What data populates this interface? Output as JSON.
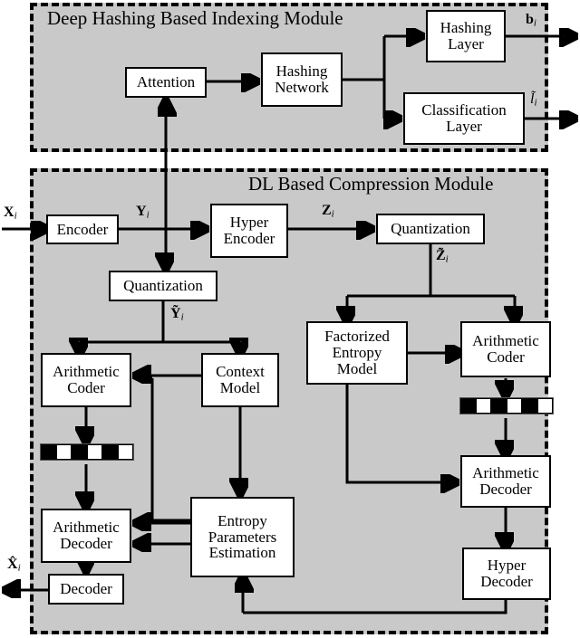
{
  "figure": {
    "title_top": "Deep Hashing Based Indexing Module",
    "title_bottom": "DL Based Compression Module",
    "module_fill": "#c9c9c9",
    "node_fill": "#ffffff",
    "stroke": "#000000"
  },
  "nodes": {
    "attention": "Attention",
    "hashing_network_l1": "Hashing",
    "hashing_network_l2": "Network",
    "hashing_layer_l1": "Hashing",
    "hashing_layer_l2": "Layer",
    "classification_layer_l1": "Classification",
    "classification_layer_l2": "Layer",
    "encoder": "Encoder",
    "hyper_encoder_l1": "Hyper",
    "hyper_encoder_l2": "Encoder",
    "quantization_left": "Quantization",
    "quantization_right": "Quantization",
    "factorized_entropy_model_l1": "Factorized",
    "factorized_entropy_model_l2": "Entropy",
    "factorized_entropy_model_l3": "Model",
    "arithmetic_coder_left_l1": "Arithmetic",
    "arithmetic_coder_left_l2": "Coder",
    "arithmetic_coder_right_l1": "Arithmetic",
    "arithmetic_coder_right_l2": "Coder",
    "context_model_l1": "Context",
    "context_model_l2": "Model",
    "entropy_params_l1": "Entropy",
    "entropy_params_l2": "Parameters",
    "entropy_params_l3": "Estimation",
    "arithmetic_decoder_left_l1": "Arithmetic",
    "arithmetic_decoder_left_l2": "Decoder",
    "arithmetic_decoder_right_l1": "Arithmetic",
    "arithmetic_decoder_right_l2": "Decoder",
    "hyper_decoder_l1": "Hyper",
    "hyper_decoder_l2": "Decoder",
    "decoder": "Decoder"
  },
  "labels": {
    "input_x": "X",
    "input_x_sub": "i",
    "output_b": "b",
    "output_b_sub": "i",
    "output_l": "l̃",
    "output_l_sub": "i",
    "y": "Y",
    "y_sub": "i",
    "z": "Z",
    "z_sub": "i",
    "y_tilde": "Ỹ",
    "y_tilde_sub": "i",
    "z_tilde": "Z̃",
    "z_tilde_sub": "i",
    "output_x_hat": "X̂",
    "output_x_hat_sub": "i"
  },
  "bitstreams": {
    "left_pattern": [
      "b",
      "w",
      "b",
      "w",
      "b",
      "w"
    ],
    "right_pattern": [
      "b",
      "w",
      "b",
      "w",
      "b",
      "w"
    ]
  }
}
